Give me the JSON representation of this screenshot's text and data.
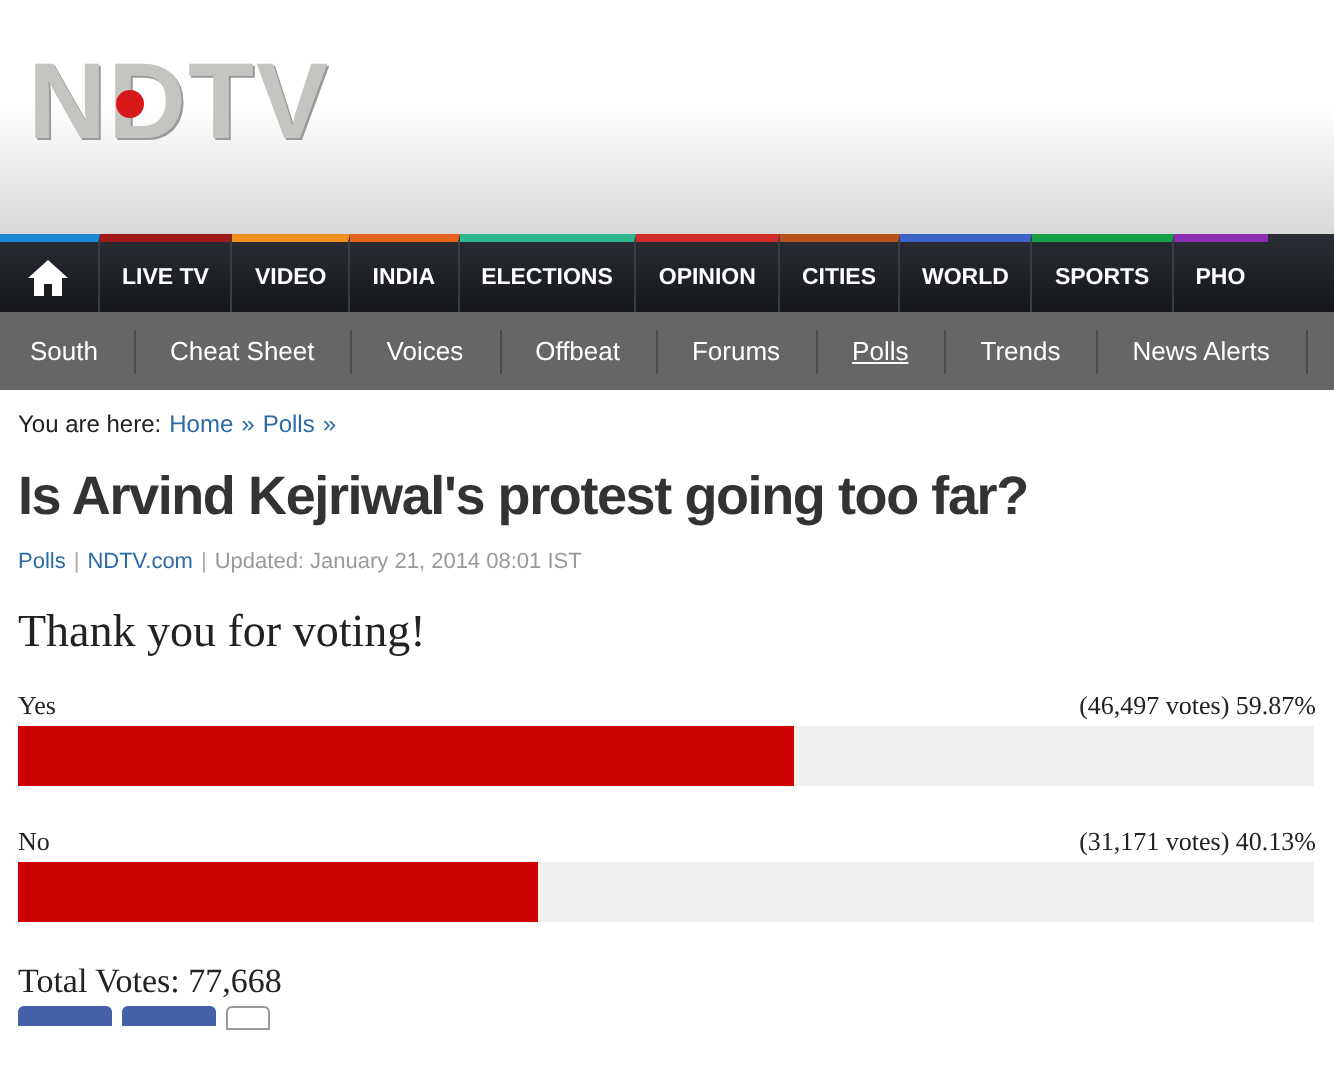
{
  "logo": {
    "text": "NDTV"
  },
  "main_nav": [
    {
      "kind": "home",
      "color": "#1e88d8"
    },
    {
      "kind": "link",
      "label": "LIVE TV",
      "color": "#a01818"
    },
    {
      "kind": "link",
      "label": "VIDEO",
      "color": "#f0901c"
    },
    {
      "kind": "link",
      "label": "INDIA",
      "color": "#e8641c"
    },
    {
      "kind": "link",
      "label": "ELECTIONS",
      "color": "#2cb88c"
    },
    {
      "kind": "link",
      "label": "OPINION",
      "color": "#d02c2c"
    },
    {
      "kind": "link",
      "label": "CITIES",
      "color": "#b8501c"
    },
    {
      "kind": "link",
      "label": "WORLD",
      "color": "#3c64c8"
    },
    {
      "kind": "link",
      "label": "SPORTS",
      "color": "#18a048"
    },
    {
      "kind": "link",
      "label": "PHO",
      "color": "#8c2cb4"
    }
  ],
  "sub_nav": [
    {
      "label": "South",
      "selected": false
    },
    {
      "label": "Cheat Sheet",
      "selected": false
    },
    {
      "label": "Voices",
      "selected": false
    },
    {
      "label": "Offbeat",
      "selected": false
    },
    {
      "label": "Forums",
      "selected": false
    },
    {
      "label": "Polls",
      "selected": true
    },
    {
      "label": "Trends",
      "selected": false
    },
    {
      "label": "News Alerts",
      "selected": false
    }
  ],
  "breadcrumb": {
    "prefix": "You are here:",
    "links": [
      "Home",
      "Polls"
    ],
    "separator": "»"
  },
  "title": "Is Arvind Kejriwal's protest going too far?",
  "meta": {
    "separator": "|",
    "section": "Polls",
    "source": "NDTV.com",
    "updated": "Updated: January 21, 2014 08:01 IST"
  },
  "thanks": "Thank you for voting!",
  "options": [
    {
      "label": "Yes",
      "result": "(46,497 votes) 59.87%",
      "level": 0.5987
    },
    {
      "label": "No",
      "result": "(31,171 votes) 40.13%",
      "level": 0.4013
    }
  ],
  "total": "Total Votes: 77,668"
}
